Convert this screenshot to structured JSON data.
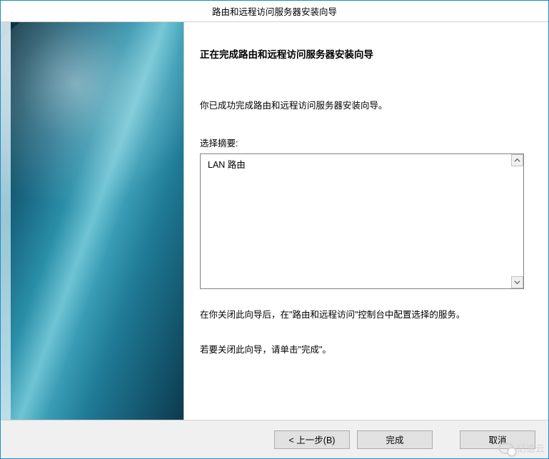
{
  "titlebar": {
    "title": "路由和远程访问服务器安装向导"
  },
  "content": {
    "heading": "正在完成路由和远程访问服务器安装向导",
    "completion_message": "你已成功完成路由和远程访问服务器安装向导。",
    "summary_label": "选择摘要:",
    "summary_text": "LAN 路由",
    "post_text": "在你关闭此向导后，在\"路由和远程访问\"控制台中配置选择的服务。",
    "close_text": "若要关闭此向导，请单击\"完成\"。"
  },
  "footer": {
    "back_label": "< 上一步(B)",
    "finish_label": "完成",
    "cancel_label": "取消"
  },
  "watermark": {
    "text": "亿速云"
  }
}
